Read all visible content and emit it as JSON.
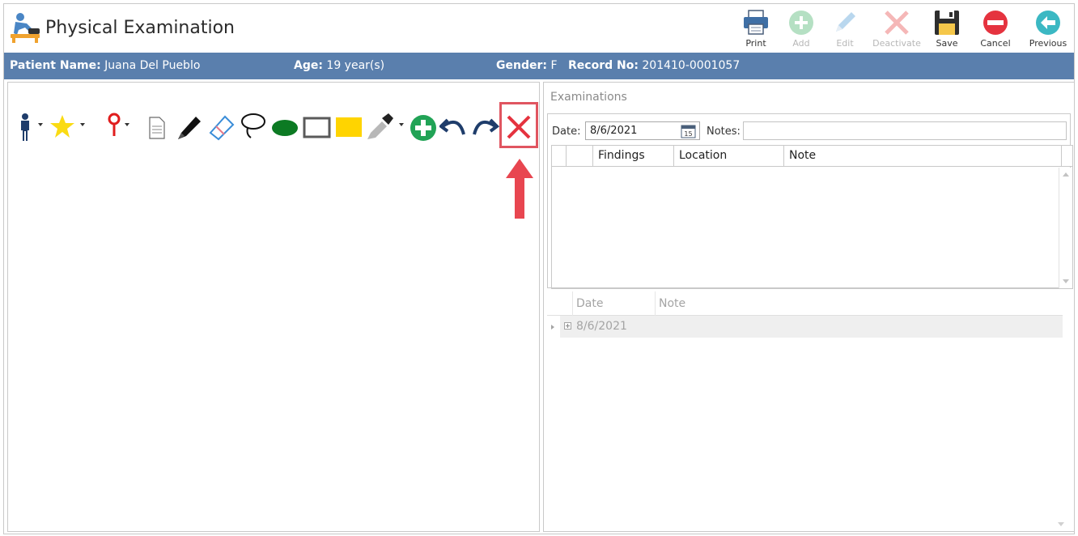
{
  "header": {
    "title": "Physical Examination",
    "toolbar": [
      {
        "label": "Print",
        "icon": "printer-icon",
        "enabled": true
      },
      {
        "label": "Add",
        "icon": "add-icon",
        "enabled": false
      },
      {
        "label": "Edit",
        "icon": "pencil-icon",
        "enabled": false
      },
      {
        "label": "Deactivate",
        "icon": "deactivate-icon",
        "enabled": false
      },
      {
        "label": "Save",
        "icon": "floppy-disk-icon",
        "enabled": true
      },
      {
        "label": "Cancel",
        "icon": "cancel-icon",
        "enabled": true
      },
      {
        "label": "Previous",
        "icon": "back-arrow-icon",
        "enabled": true
      }
    ]
  },
  "patient": {
    "name_label": "Patient Name:",
    "name": "Juana Del Pueblo",
    "age_label": "Age:",
    "age": "19 year(s)",
    "gender_label": "Gender:",
    "gender": "F",
    "record_label": "Record No:",
    "record": "201410-0001057"
  },
  "drawing_tools": [
    "body-figure-icon",
    "star-icon",
    "map-pin-icon",
    "document-icon",
    "pen-icon",
    "eraser-icon",
    "lasso-icon",
    "ellipse-icon",
    "rectangle-icon",
    "fill-rectangle-icon",
    "eyedropper-icon",
    "add-circle-icon",
    "undo-icon",
    "redo-icon",
    "clear-x-icon"
  ],
  "examinations": {
    "title": "Examinations",
    "date_label": "Date:",
    "date_value": "8/6/2021",
    "notes_label": "Notes:",
    "notes_value": "",
    "columns": [
      "Findings",
      "Location",
      "Note"
    ]
  },
  "history": {
    "columns": [
      "Date",
      "Note"
    ],
    "rows": [
      {
        "date": "8/6/2021"
      }
    ]
  },
  "colors": {
    "patient_bar": "#5a7fad",
    "highlight": "#e05560"
  }
}
